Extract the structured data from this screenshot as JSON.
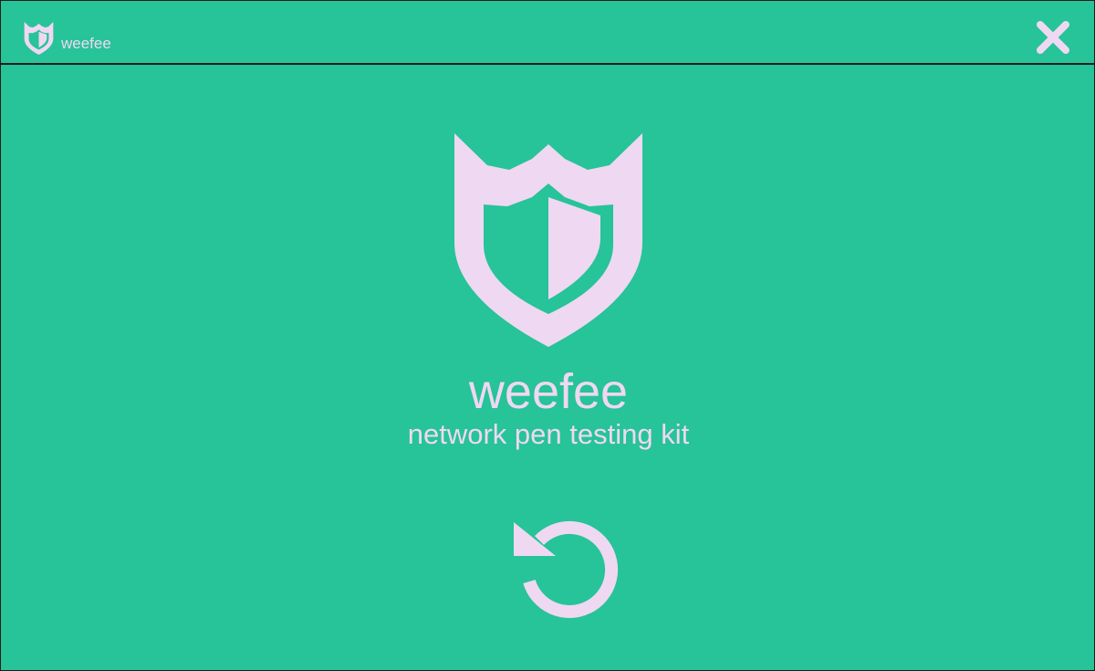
{
  "app": {
    "name": "weefee",
    "title": "weefee",
    "subtitle": "network pen testing kit"
  },
  "icons": {
    "app": "shield-icon",
    "close": "close-icon",
    "restart": "restart-icon"
  },
  "colors": {
    "background": "#27c399",
    "foreground": "#efd8f2",
    "border": "#1d1d1d"
  }
}
